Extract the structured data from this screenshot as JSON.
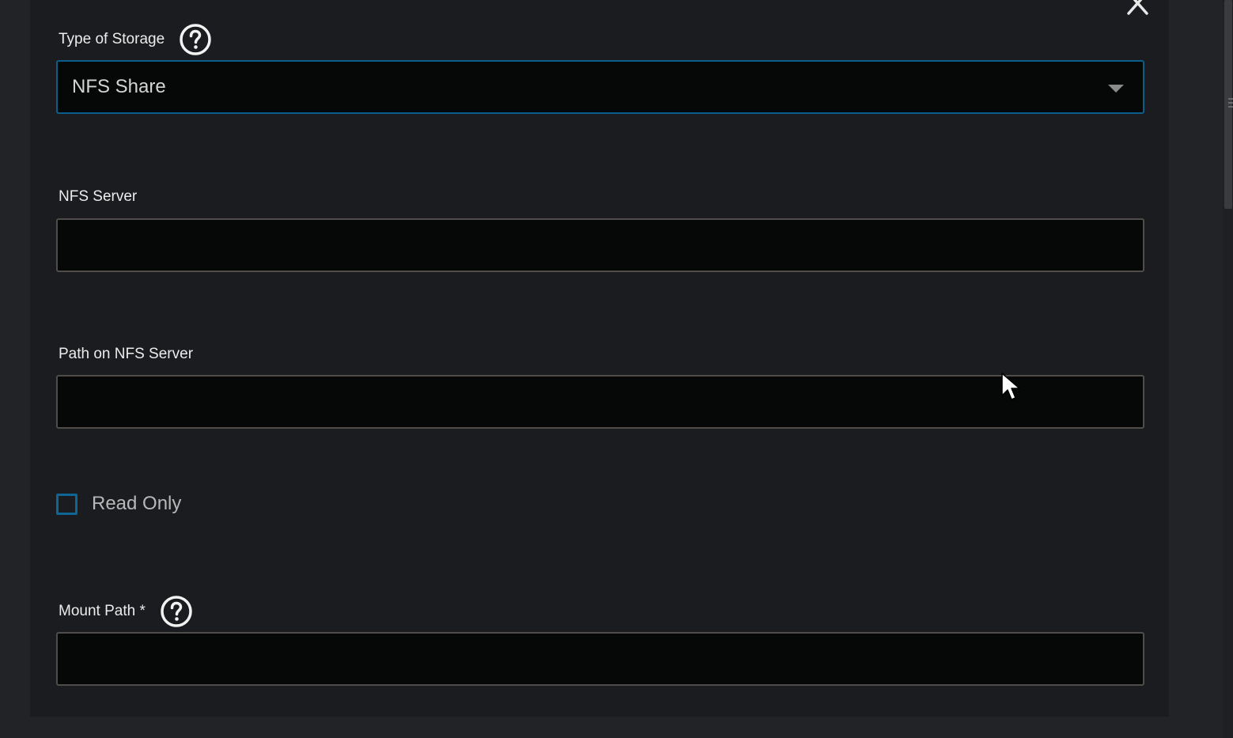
{
  "dialog": {
    "close_icon": "close-icon",
    "storage_type": {
      "label": "Type of Storage",
      "help_icon": "help-circle-icon",
      "selected_value": "NFS Share",
      "dropdown_icon": "chevron-down-icon"
    },
    "nfs_server": {
      "label": "NFS Server",
      "value": ""
    },
    "nfs_path": {
      "label": "Path on NFS Server",
      "value": ""
    },
    "read_only": {
      "label": "Read Only",
      "checked": false
    },
    "mount_path": {
      "label": "Mount Path *",
      "help_icon": "help-circle-icon",
      "value": ""
    }
  },
  "colors": {
    "panel_bg": "#1b1c1f",
    "input_bg": "#060808",
    "input_border": "#4f4c49",
    "focus_accent": "#0b5d8c",
    "checkbox_accent": "#0d6696",
    "label_text": "#ececec"
  }
}
